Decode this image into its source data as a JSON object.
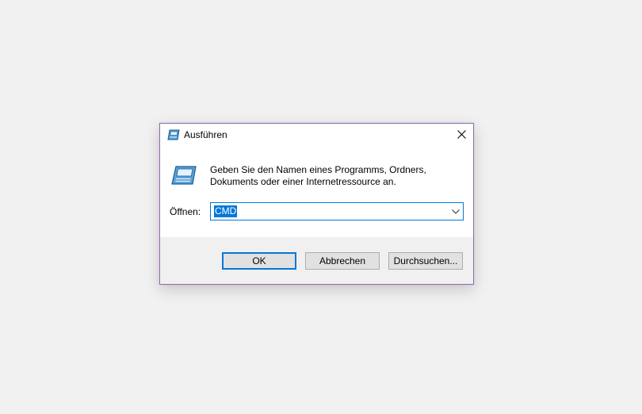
{
  "dialog": {
    "title": "Ausführen",
    "title_icon": "run-icon",
    "close_icon": "close-icon",
    "description": "Geben Sie den Namen eines Programms, Ordners, Dokuments oder einer Internetressource an.",
    "big_icon": "run-icon"
  },
  "open_field": {
    "label": "Öffnen:",
    "value": "CMD",
    "dropdown_icon": "chevron-down-icon"
  },
  "buttons": {
    "ok_label": "OK",
    "cancel_label": "Abbrechen",
    "browse_label": "Durchsuchen..."
  },
  "colors": {
    "accent": "#0078d7",
    "window_border": "#8f6bb5",
    "footer_bg": "#f0f0f0",
    "desktop_bg": "#f2f1f1"
  }
}
